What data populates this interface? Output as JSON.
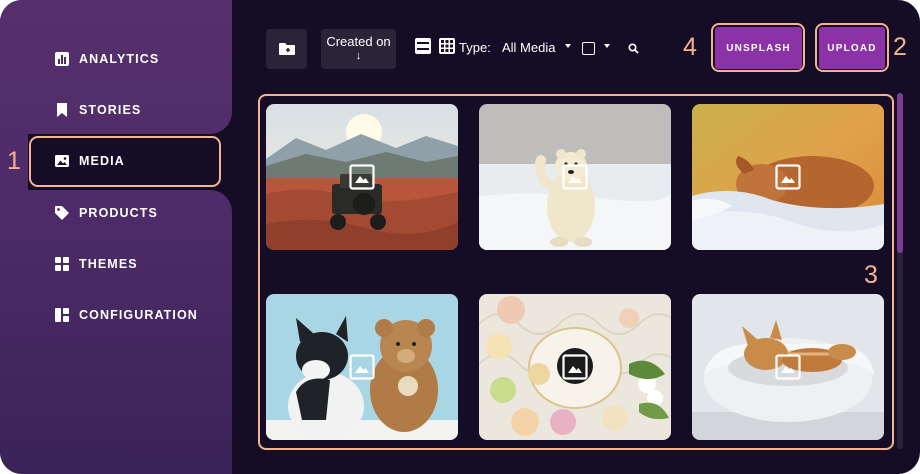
{
  "sidebar": {
    "items": [
      {
        "label": "ANALYTICS",
        "icon": "analytics-icon"
      },
      {
        "label": "STORIES",
        "icon": "bookmark-icon"
      },
      {
        "label": "MEDIA",
        "icon": "image-icon"
      },
      {
        "label": "PRODUCTS",
        "icon": "tag-icon"
      },
      {
        "label": "THEMES",
        "icon": "grid-icon"
      },
      {
        "label": "CONFIGURATION",
        "icon": "layout-icon"
      }
    ]
  },
  "toolbar": {
    "sort_label": "Created on",
    "sort_arrow": "↓",
    "type_label": "Type:",
    "type_value": "All Media",
    "unsplash_label": "UNSPLASH",
    "upload_label": "UPLOAD"
  },
  "annotations": {
    "marker_1": "1",
    "marker_2": "2",
    "marker_3": "3",
    "marker_4": "4"
  },
  "media": {
    "items": [
      {
        "subject": "jeep-desert"
      },
      {
        "subject": "polar-bear"
      },
      {
        "subject": "sleeping-dog"
      },
      {
        "subject": "cat-teddy-bear"
      },
      {
        "subject": "macarons-coffee"
      },
      {
        "subject": "cat-in-bed"
      }
    ]
  },
  "colors": {
    "accent": "#8a32a6",
    "highlight": "#f3b48e",
    "background": "#150d26",
    "sidebar": "#4d2b68"
  }
}
